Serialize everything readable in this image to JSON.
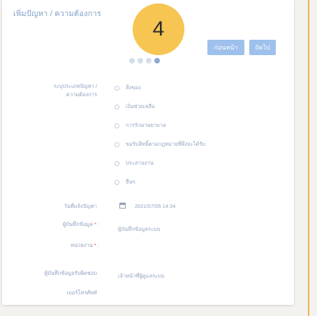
{
  "page": {
    "title": "เพิ่มปัญหา / ความต้องการ",
    "step_number": "4",
    "steps": {
      "total": 4,
      "current": 4
    }
  },
  "buttons": {
    "back_label": "ก่อนหน้า",
    "next_label": "ถัดไป"
  },
  "form": {
    "category_label": "ระบุประเภทปัญหา / ความต้องการ",
    "category_label_line1": "ระบุประเภทปัญหา /",
    "category_label_line2": "ความต้องการ",
    "category_options": [
      "สิ่งของ",
      "เงินช่วยเหลือ",
      "การรักษาพยาบาล",
      "ขอรับสิทธิ์ตามกฎหมายที่พึงจะได้รับ",
      "ประสานงาน",
      "อื่นๆ"
    ],
    "selected_option_index": -1,
    "date_label": "วันที่แจ้งปัญหา",
    "date_value": "2021/07/05 14:34",
    "recorder_label": "ผู้บันทึกข้อมูล",
    "recorder_value": "ผู้บันทึกข้อมูลระบบ",
    "agency_label": "หน่วยงาน",
    "responsible_label_line1": "ผู้บันทึกข้อมูลรับผิดชอบ",
    "responsible_label_line2": "เบอร์โทรศัพท์",
    "responsible_value": "เจ้าหน้าที่ผู้ดูแลระบบ"
  },
  "colors": {
    "accent_yellow": "#f6c552",
    "button_blue": "#9ec0ec",
    "label_blue": "#8fa2c0",
    "required_red": "#e05757",
    "side_rule_orange": "#f3b24c"
  }
}
